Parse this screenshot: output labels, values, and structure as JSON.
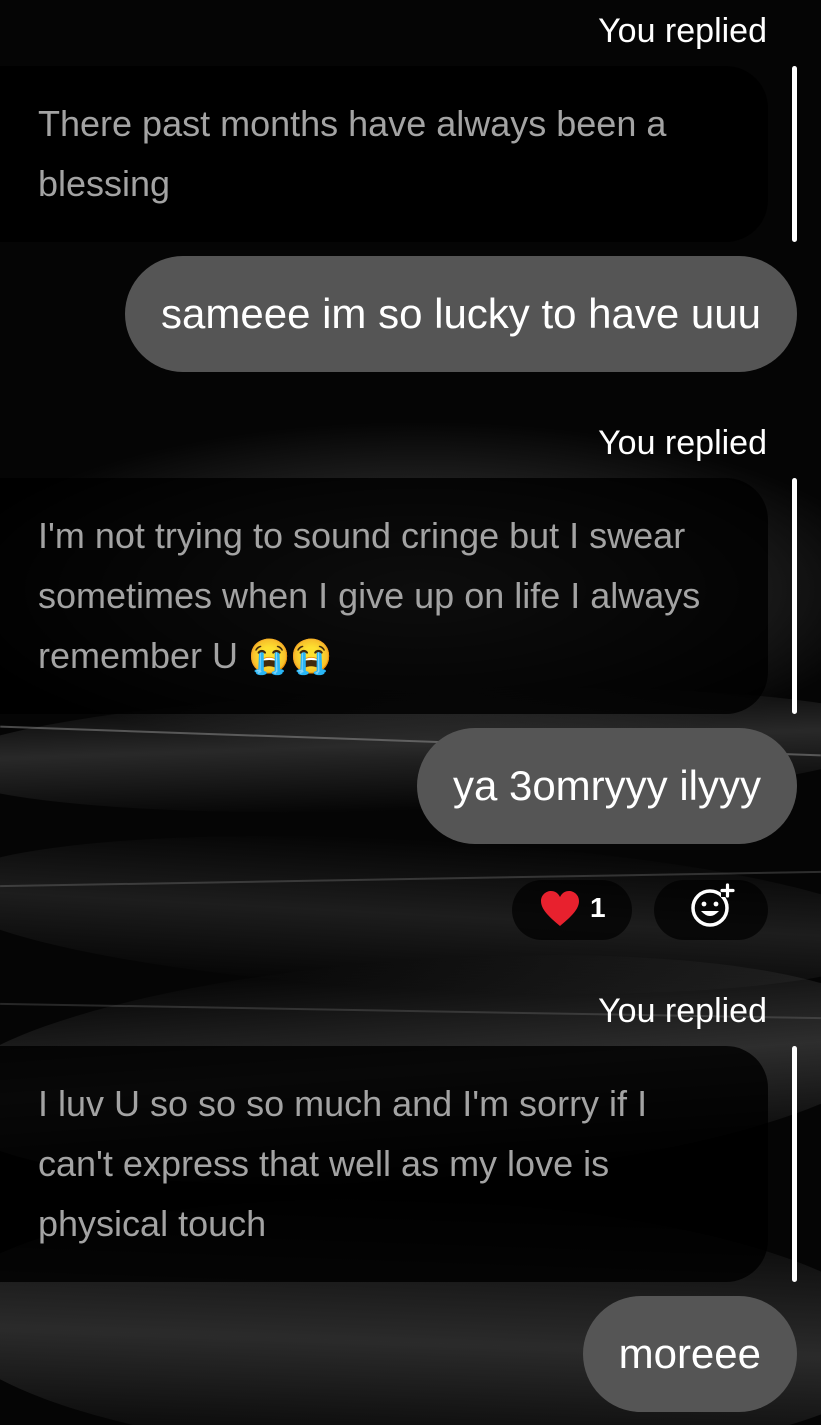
{
  "messages": [
    {
      "replied_label": "You replied",
      "quote_text": "There past months have always been a blessing",
      "reply_text": "sameee im so lucky to have uuu"
    },
    {
      "replied_label": "You replied",
      "quote_text": "I'm not trying to sound cringe but I swear sometimes when I give up on life I always remember U",
      "quote_emojis": "😭😭",
      "reply_text": "ya 3omryyy ilyyy",
      "reaction": {
        "emoji": "❤️",
        "count": "1"
      }
    },
    {
      "replied_label": "You replied",
      "quote_text": "I luv U so so so much and I'm sorry if I can't express that well as my love is physical touch",
      "reply_text": "moreee"
    }
  ],
  "icons": {
    "heart": "heart-reaction-icon",
    "add_reaction": "add-reaction-icon"
  },
  "colors": {
    "bubble": "#555555",
    "quote_text": "#a3a3a3",
    "heart": "#e8212e"
  }
}
